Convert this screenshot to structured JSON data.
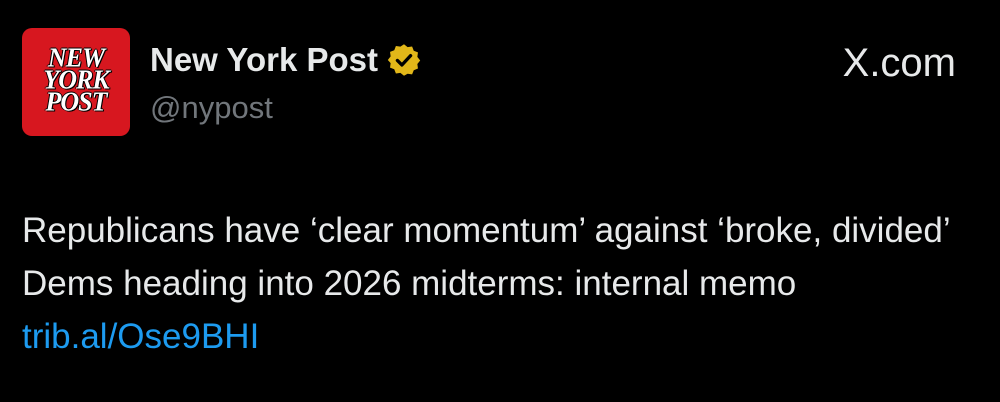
{
  "account": {
    "avatar_lines": [
      "NEW",
      "YORK",
      "POST"
    ],
    "display_name": "New York Post",
    "handle": "@nypost",
    "verified_badge": "gold-verified-badge"
  },
  "site": {
    "label": "X.com"
  },
  "tweet": {
    "text": "Republicans have ‘clear momentum’ against ‘broke, divided’ Dems heading into 2026 midterms: internal memo ",
    "link": "trib.al/Ose9BHI"
  },
  "colors": {
    "background": "#000000",
    "text": "#e7e9ea",
    "secondary_text": "#71767b",
    "link": "#1d9bf0",
    "avatar_red": "#d7171f",
    "badge_gold": "#e2b719"
  }
}
